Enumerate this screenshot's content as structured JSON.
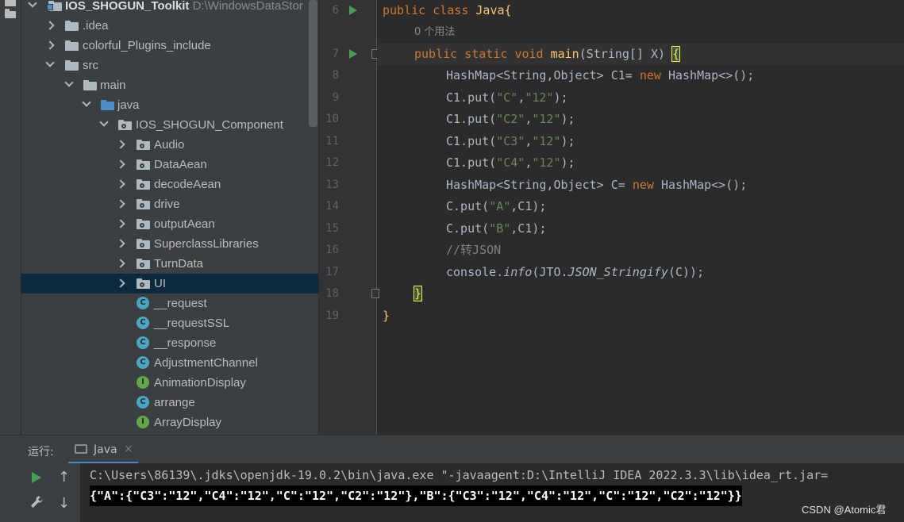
{
  "project": {
    "root_name": "IOS_SHOGUN_Toolkit",
    "root_path": "D:\\WindowsDataStor",
    "items": [
      {
        "label": ".idea"
      },
      {
        "label": "colorful_Plugins_include"
      },
      {
        "label": "src"
      },
      {
        "label": "main"
      },
      {
        "label": "java"
      },
      {
        "label": "IOS_SHOGUN_Component"
      },
      {
        "label": "Audio"
      },
      {
        "label": "DataAean"
      },
      {
        "label": "decodeAean"
      },
      {
        "label": "drive"
      },
      {
        "label": "outputAean"
      },
      {
        "label": "SuperclassLibraries"
      },
      {
        "label": "TurnData"
      },
      {
        "label": "UI"
      },
      {
        "label": "__request",
        "kind": "C"
      },
      {
        "label": "__requestSSL",
        "kind": "C"
      },
      {
        "label": "__response",
        "kind": "C"
      },
      {
        "label": "AdjustmentChannel",
        "kind": "C"
      },
      {
        "label": "AnimationDisplay",
        "kind": "I"
      },
      {
        "label": "arrange",
        "kind": "C"
      },
      {
        "label": "ArrayDisplay",
        "kind": "I"
      }
    ]
  },
  "editor": {
    "line_numbers": [
      "6",
      "7",
      "8",
      "9",
      "10",
      "11",
      "12",
      "13",
      "14",
      "15",
      "16",
      "17",
      "18",
      "19"
    ],
    "usages_hint": "0 个用法",
    "code": {
      "l6_kw": "public class ",
      "l6_name": "Java",
      "l6_brace": "{",
      "l7_kw": "public static void ",
      "l7_fn": "main",
      "l7_args": "(String[] X) ",
      "l7_brace": "{",
      "l8": [
        "HashMap<String,Object> C1= ",
        "new ",
        "HashMap<>();"
      ],
      "l9": [
        "C1.put(",
        "\"C\"",
        ",",
        "\"12\"",
        ");"
      ],
      "l10": [
        "C1.put(",
        "\"C2\"",
        ",",
        "\"12\"",
        ");"
      ],
      "l11": [
        "C1.put(",
        "\"C3\"",
        ",",
        "\"12\"",
        ");"
      ],
      "l12": [
        "C1.put(",
        "\"C4\"",
        ",",
        "\"12\"",
        ");"
      ],
      "l13": [
        "HashMap<String,Object> C= ",
        "new ",
        "HashMap<>();"
      ],
      "l14": [
        "C.put(",
        "\"A\"",
        ",C1);"
      ],
      "l15": [
        "C.put(",
        "\"B\"",
        ",C1);"
      ],
      "l16": "//转JSON",
      "l17": [
        "console.",
        "info",
        "(JTO.",
        "JSON_Stringify",
        "(C));"
      ],
      "l18": "}",
      "l19": "}"
    }
  },
  "run_panel": {
    "label": "运行:",
    "tab_label": "Java",
    "tab_close": "×",
    "command": "C:\\Users\\86139\\.jdks\\openjdk-19.0.2\\bin\\java.exe \"-javaagent:D:\\IntelliJ IDEA 2022.3.3\\lib\\idea_rt.jar=",
    "output": "{\"A\":{\"C3\":\"12\",\"C4\":\"12\",\"C\":\"12\",\"C2\":\"12\"},\"B\":{\"C3\":\"12\",\"C4\":\"12\",\"C\":\"12\",\"C2\":\"12\"}}",
    "up_arrow": "↑",
    "down_arrow": "↓",
    "wrench": "🔧"
  },
  "watermark": "CSDN @Atomic君"
}
